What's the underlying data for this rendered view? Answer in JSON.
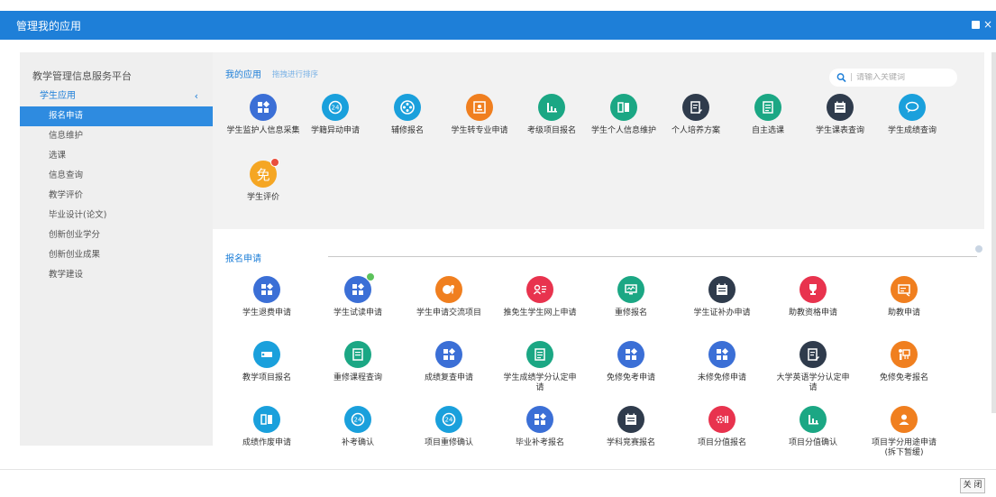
{
  "window": {
    "title": "管理我的应用",
    "close_label": "关 闭"
  },
  "sidebar": {
    "platform": "教学管理信息服务平台",
    "group": "学生应用",
    "items": [
      "报名申请",
      "信息维护",
      "选课",
      "信息查询",
      "教学评价",
      "毕业设计(论文)",
      "创新创业学分",
      "创新创业成果",
      "教学建设"
    ]
  },
  "my_apps": {
    "title": "我的应用",
    "hint": "拖拽进行排序",
    "search_placeholder": "请输入关键词",
    "items": [
      {
        "label": "学生监护人信息采集",
        "icon": "grid-icon",
        "color": "#3b6fd6"
      },
      {
        "label": "学籍异动申请",
        "icon": "24-clock-icon",
        "color": "#1aa0dc"
      },
      {
        "label": "辅修报名",
        "icon": "film-reel-icon",
        "color": "#1aa0dc"
      },
      {
        "label": "学生转专业申请",
        "icon": "id-card-icon",
        "color": "#f07f1f"
      },
      {
        "label": "考级项目报名",
        "icon": "bar-chart-icon",
        "color": "#1ba784"
      },
      {
        "label": "学生个人信息维护",
        "icon": "book-icon",
        "color": "#1ba784"
      },
      {
        "label": "个人培养方案",
        "icon": "doc-edit-icon",
        "color": "#2f3b4c"
      },
      {
        "label": "自主选课",
        "icon": "document-icon",
        "color": "#1ba784"
      },
      {
        "label": "学生课表查询",
        "icon": "calendar-icon",
        "color": "#2f3b4c"
      },
      {
        "label": "学生成绩查询",
        "icon": "chat-icon",
        "color": "#1aa0dc"
      },
      {
        "label": "学生评价",
        "icon": "mian-text-icon",
        "color": "#f5a623",
        "glyph": "免"
      }
    ]
  },
  "apply": {
    "title": "报名申请",
    "items": [
      {
        "label": "学生退费申请",
        "icon": "grid-icon",
        "color": "#3b6fd6"
      },
      {
        "label": "学生试读申请",
        "icon": "grid-icon",
        "color": "#3b6fd6"
      },
      {
        "label": "学生申请交流项目",
        "icon": "pie-key-icon",
        "color": "#f07f1f"
      },
      {
        "label": "推免生学生网上申请",
        "icon": "user-list-icon",
        "color": "#e8334e"
      },
      {
        "label": "重修报名",
        "icon": "monitor-icon",
        "color": "#1ba784"
      },
      {
        "label": "学生证补办申请",
        "icon": "calendar-icon",
        "color": "#2f3b4c"
      },
      {
        "label": "助教资格申请",
        "icon": "trophy-icon",
        "color": "#e8334e"
      },
      {
        "label": "助教申请",
        "icon": "presentation-icon",
        "color": "#f07f1f"
      },
      {
        "label": "教学项目报名",
        "icon": "ticket-icon",
        "color": "#1aa0dc"
      },
      {
        "label": "重修课程查询",
        "icon": "notebook-icon",
        "color": "#1ba784"
      },
      {
        "label": "成绩复查申请",
        "icon": "grid-icon",
        "color": "#3b6fd6"
      },
      {
        "label": "学生成绩学分认定申请",
        "icon": "document-icon",
        "color": "#1ba784"
      },
      {
        "label": "免修免考申请",
        "icon": "grid-icon",
        "color": "#3b6fd6"
      },
      {
        "label": "未修免修申请",
        "icon": "grid-icon",
        "color": "#3b6fd6"
      },
      {
        "label": "大学英语学分认定申请",
        "icon": "doc-edit-icon",
        "color": "#2f3b4c"
      },
      {
        "label": "免修免考报名",
        "icon": "person-board-icon",
        "color": "#f07f1f"
      },
      {
        "label": "成绩作废申请",
        "icon": "book-icon",
        "color": "#1aa0dc"
      },
      {
        "label": "补考确认",
        "icon": "24-clock-icon",
        "color": "#1aa0dc"
      },
      {
        "label": "项目重修确认",
        "icon": "24-clock-icon",
        "color": "#1aa0dc"
      },
      {
        "label": "毕业补考报名",
        "icon": "grid-icon",
        "color": "#3b6fd6"
      },
      {
        "label": "学科竞赛报名",
        "icon": "calendar-icon",
        "color": "#2f3b4c"
      },
      {
        "label": "项目分值报名",
        "icon": "gear-list-icon",
        "color": "#e8334e"
      },
      {
        "label": "项目分值确认",
        "icon": "bar-chart-icon",
        "color": "#1ba784"
      },
      {
        "label": "项目学分用途申请(拆下暂缓)",
        "icon": "person-icon",
        "color": "#f07f1f"
      }
    ]
  }
}
